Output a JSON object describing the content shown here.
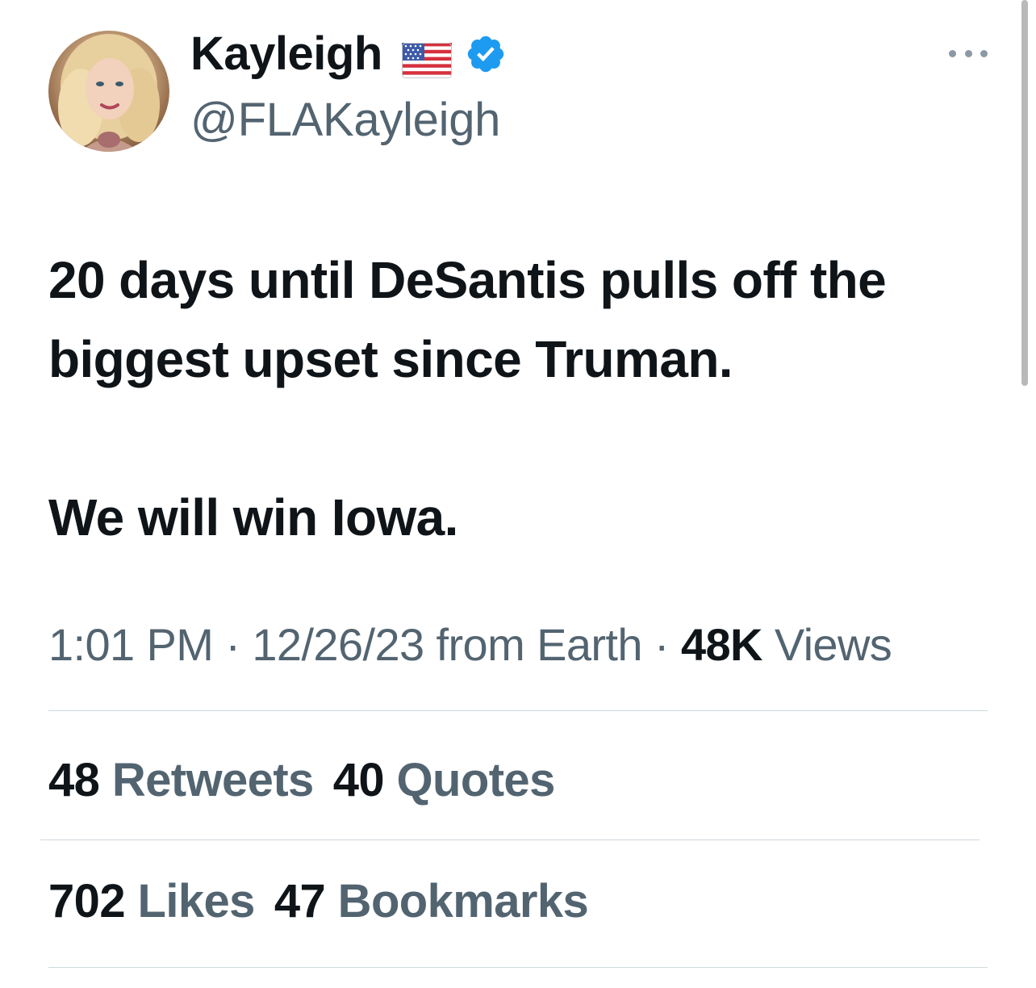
{
  "author": {
    "display_name": "Kayleigh",
    "handle": "@FLAKayleigh",
    "flag_icon": "us-flag-icon",
    "verified": true,
    "verified_color": "#1d9bf0"
  },
  "tweet": {
    "paragraphs": [
      "20 days until DeSantis pulls off the biggest upset since Truman.",
      "We will win Iowa."
    ]
  },
  "meta": {
    "time": "1:01 PM",
    "separator": "·",
    "date": "12/26/23",
    "source": "from Earth",
    "views_count": "48K",
    "views_label": "Views"
  },
  "stats": {
    "retweets_count": "48",
    "retweets_label": "Retweets",
    "quotes_count": "40",
    "quotes_label": "Quotes",
    "likes_count": "702",
    "likes_label": "Likes",
    "bookmarks_count": "47",
    "bookmarks_label": "Bookmarks"
  },
  "colors": {
    "text_primary": "#0f1419",
    "text_secondary": "#536471",
    "divider": "#cfd9de",
    "accent": "#1d9bf0"
  }
}
